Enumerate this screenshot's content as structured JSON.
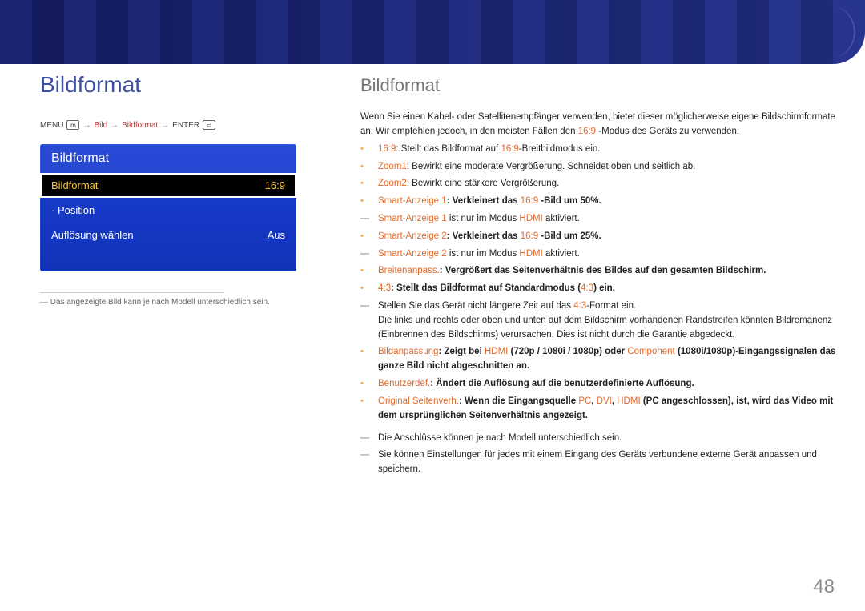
{
  "banner": {},
  "left": {
    "title": "Bildformat",
    "nav": {
      "menu": "MENU",
      "p1": "Bild",
      "p2": "Bildformat",
      "enter": "ENTER"
    },
    "osd": {
      "header": "Bildformat",
      "rows": [
        {
          "label": "Bildformat",
          "value": "16:9",
          "selected": true
        },
        {
          "label": "Position",
          "value": "",
          "sub": true
        },
        {
          "label": "Auﬂösung wählen",
          "value": "Aus"
        }
      ]
    },
    "footnote": "Das angezeigte Bild kann je nach Modell unterschiedlich sein."
  },
  "right": {
    "title": "Bildformat",
    "intro1": "Wenn Sie einen Kabel- oder Satellitenempfänger verwenden, bietet dieser möglicherweise eigene Bildschirmformate an. Wir empfehlen jedoch, in den meisten Fällen den ",
    "intro1_hl": "16:9",
    "intro1_tail": "-Modus des Geräts zu verwenden.",
    "items": [
      {
        "hl": "16:9",
        "text": ": Stellt das Bildformat auf ",
        "hl2": "16:9",
        "tail": "-Breitbildmodus ein."
      },
      {
        "hl": "Zoom1",
        "text": ": Bewirkt eine moderate Vergrößerung. Schneidet oben und seitlich ab."
      },
      {
        "hl": "Zoom2",
        "text": ": Bewirkt eine stärkere Vergrößerung."
      },
      {
        "hl": "Smart-Anzeige 1",
        "text": ": Verkleinert das ",
        "hl2": "16:9",
        "tail": " -Bild um 50%."
      },
      {
        "dash": true,
        "pre": "",
        "hl": "Smart-Anzeige 1",
        "text": " ist nur im Modus ",
        "hl2": "HDMI",
        "tail": " aktiviert."
      },
      {
        "hl": "Smart-Anzeige 2",
        "text": ": Verkleinert das ",
        "hl2": "16:9",
        "tail": " -Bild um 25%."
      },
      {
        "dash": true,
        "pre": "",
        "hl": "Smart-Anzeige 2",
        "text": " ist nur im Modus ",
        "hl2": "HDMI",
        "tail": " aktiviert."
      },
      {
        "hl": "Breitenanpass.",
        "text": ": Vergrößert das Seitenverhältnis des Bildes auf den gesamten Bildschirm."
      },
      {
        "hl": "4:3",
        "text": ": Stellt das Bildformat auf Standardmodus (",
        "hl2": "4:3",
        "tail": ") ein."
      },
      {
        "dash": true,
        "text_full": "Stellen Sie das Gerät nicht längere Zeit auf das ",
        "hl": "4:3",
        "tail": "-Format ein.\nDie links und rechts oder oben und unten auf dem Bildschirm vorhandenen Randstreifen könnten Bildremanenz (Einbrennen des Bildschirms) verursachen. Dies ist nicht durch die Garantie abgedeckt."
      },
      {
        "hl": "Bildanpassung",
        "text": ": Zeigt bei ",
        "hl2": "HDMI",
        "mid": " (720p / 1080i / 1080p) oder ",
        "hl3": "Component",
        "mid2": " (1080i/1080p)-Eingangssignalen das ganze Bild nicht abgeschnitten an."
      },
      {
        "hl": "Benutzerdef.",
        "text": ": Ändert die Auflösung auf die benutzerdefinierte Auflösung."
      },
      {
        "hl": "Original Seitenverh.",
        "text": ": Wenn die Eingangsquelle ",
        "hl2": "PC",
        "mid": ", ",
        "hl3": "DVI",
        "mid2": ", ",
        "hl4": "HDMI",
        "tail": " (PC angeschlossen), ist, wird das Video mit dem ursprünglichen Seitenverhältnis angezeigt."
      }
    ],
    "closing": [
      "Die Anschlüsse können je nach Modell unterschiedlich sein.",
      "Sie können Einstellungen für jedes mit einem Eingang des Geräts verbundene externe Gerät anpassen und speichern."
    ]
  },
  "page": "48"
}
